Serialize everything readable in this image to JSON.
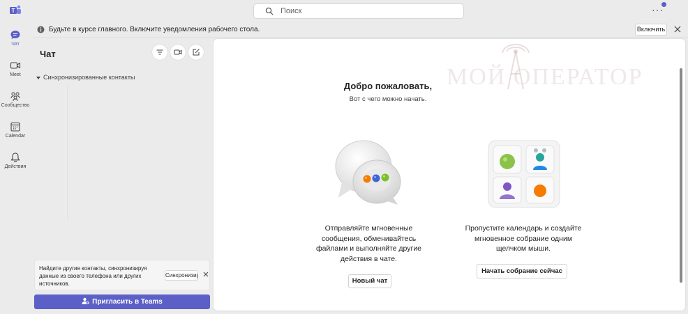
{
  "search": {
    "placeholder": "Поиск"
  },
  "rail": [
    {
      "label": "Чат"
    },
    {
      "label": "Meet"
    },
    {
      "label": "Сообщество"
    },
    {
      "label": "Calendar"
    },
    {
      "label": "Действия"
    }
  ],
  "notification": {
    "text": "Будьте в курсе главного. Включите уведомления рабочего стола.",
    "button": "Включить"
  },
  "chat_panel": {
    "title": "Чат",
    "section": "Синхронизированные контакты",
    "sync_card": {
      "text": "Найдите другие контакты, синхронизируя данные из своего телефона или других источников.",
      "button": "Синхронизировать"
    },
    "invite_button": "Пригласить в Teams"
  },
  "main": {
    "welcome": "Добро пожаловать,",
    "subtitle": "Вот с чего можно начать.",
    "watermark": "МОЙ ОПЕРАТОР",
    "left": {
      "description": "Отправляйте мгновенные сообщения, обменивайтесь файлами и выполняйте другие действия в чате.",
      "button": "Новый чат"
    },
    "right": {
      "description": "Пропустите календарь и создайте мгновенное собрание одним щелчком мыши.",
      "button": "Начать собрание сейчас"
    }
  },
  "colors": {
    "accent": "#5b5fc7",
    "background": "#ebebeb",
    "card": "#ffffff"
  }
}
